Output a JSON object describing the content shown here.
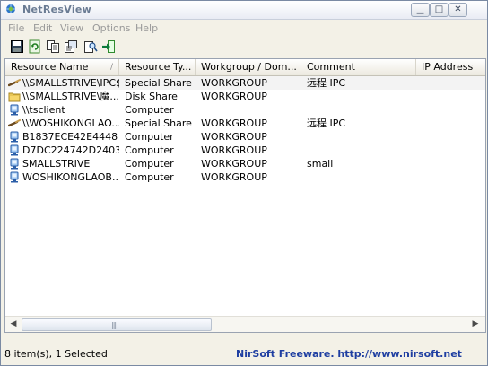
{
  "window": {
    "title": "NetResView"
  },
  "menu": [
    "File",
    "Edit",
    "View",
    "Options",
    "Help"
  ],
  "toolbar": {
    "icons": [
      "save-icon",
      "refresh-icon",
      "copy-icon",
      "properties-icon",
      "find-icon",
      "exit-icon"
    ]
  },
  "columns": [
    "Resource Name",
    "Resource Ty...",
    "Workgroup / Dom...",
    "Comment",
    "IP Address"
  ],
  "rows": [
    {
      "name": "\\\\SMALLSTRIVE\\IPC$",
      "type": "Special Share",
      "workgroup": "WORKGROUP",
      "comment": "远程 IPC",
      "ip": "",
      "icon": "share-pipe-icon",
      "selected": true
    },
    {
      "name": "\\\\SMALLSTRIVE\\魔...",
      "type": "Disk Share",
      "workgroup": "WORKGROUP",
      "comment": "",
      "ip": "",
      "icon": "folder-icon",
      "selected": false
    },
    {
      "name": "\\\\tsclient",
      "type": "Computer",
      "workgroup": "",
      "comment": "",
      "ip": "",
      "icon": "computer-icon",
      "selected": false
    },
    {
      "name": "\\\\WOSHIKONGLAO...",
      "type": "Special Share",
      "workgroup": "WORKGROUP",
      "comment": "远程 IPC",
      "ip": "",
      "icon": "share-pipe-icon",
      "selected": false
    },
    {
      "name": "B1837ECE42E4448",
      "type": "Computer",
      "workgroup": "WORKGROUP",
      "comment": "",
      "ip": "",
      "icon": "computer-icon",
      "selected": false
    },
    {
      "name": "D7DC224742D2403",
      "type": "Computer",
      "workgroup": "WORKGROUP",
      "comment": "",
      "ip": "",
      "icon": "computer-icon",
      "selected": false
    },
    {
      "name": "SMALLSTRIVE",
      "type": "Computer",
      "workgroup": "WORKGROUP",
      "comment": "small",
      "ip": "",
      "icon": "computer-icon",
      "selected": false
    },
    {
      "name": "WOSHIKONGLAOB...",
      "type": "Computer",
      "workgroup": "WORKGROUP",
      "comment": "",
      "ip": "",
      "icon": "computer-icon",
      "selected": false
    }
  ],
  "status": {
    "left": "8 item(s), 1 Selected",
    "right": "NirSoft Freeware.  http://www.nirsoft.net"
  }
}
